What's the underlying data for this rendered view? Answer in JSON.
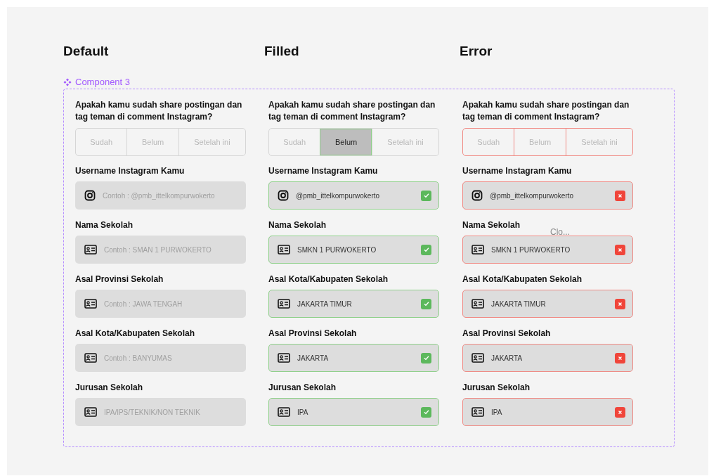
{
  "component_label": "Component 3",
  "columns": [
    {
      "title": "Default",
      "kind": "default",
      "question": "Apakah kamu sudah share postingan dan tag teman di comment Instagram?",
      "options": [
        {
          "label": "Sudah",
          "selected": false
        },
        {
          "label": "Belum",
          "selected": false
        },
        {
          "label": "Setelah ini",
          "selected": false
        }
      ],
      "fields": [
        {
          "label": "Username Instagram Kamu",
          "kind": "instagram",
          "placeholder": "Contoh : @pmb_ittelkompurwokerto"
        },
        {
          "label": "Nama Sekolah",
          "kind": "card",
          "placeholder": "Contoh : SMAN 1 PURWOKERTO"
        },
        {
          "label": "Asal Provinsi Sekolah",
          "kind": "card",
          "placeholder": "Contoh : JAWA TENGAH"
        },
        {
          "label": "Asal Kota/Kabupaten Sekolah",
          "kind": "card",
          "placeholder": "Contoh : BANYUMAS"
        },
        {
          "label": "Jurusan Sekolah",
          "kind": "card",
          "placeholder": "IPA/IPS/TEKNIK/NON TEKNIK"
        }
      ]
    },
    {
      "title": "Filled",
      "kind": "success",
      "question": "Apakah kamu sudah share postingan dan tag teman di comment Instagram?",
      "options": [
        {
          "label": "Sudah",
          "selected": false
        },
        {
          "label": "Belum",
          "selected": true
        },
        {
          "label": "Setelah ini",
          "selected": false
        }
      ],
      "fields": [
        {
          "label": "Username Instagram Kamu",
          "kind": "instagram",
          "value": "@pmb_ittelkompurwokerto"
        },
        {
          "label": "Nama Sekolah",
          "kind": "card",
          "value": "SMKN 1 PURWOKERTO"
        },
        {
          "label": "Asal Kota/Kabupaten Sekolah",
          "kind": "card",
          "value": "JAKARTA TIMUR"
        },
        {
          "label": "Asal Provinsi Sekolah",
          "kind": "card",
          "value": "JAKARTA"
        },
        {
          "label": "Jurusan Sekolah",
          "kind": "card",
          "value": "IPA"
        }
      ]
    },
    {
      "title": "Error",
      "kind": "error",
      "question": "Apakah kamu sudah share postingan dan tag teman di comment Instagram?",
      "options": [
        {
          "label": "Sudah",
          "selected": false
        },
        {
          "label": "Belum",
          "selected": false
        },
        {
          "label": "Setelah ini",
          "selected": false
        }
      ],
      "overlay_text": "Clo...",
      "fields": [
        {
          "label": "Username Instagram Kamu",
          "kind": "instagram",
          "value": "@pmb_ittelkompurwokerto"
        },
        {
          "label": "Nama Sekolah",
          "kind": "card",
          "value": "SMKN 1 PURWOKERTO"
        },
        {
          "label": "Asal Kota/Kabupaten Sekolah",
          "kind": "card",
          "value": "JAKARTA TIMUR"
        },
        {
          "label": "Asal Provinsi Sekolah",
          "kind": "card",
          "value": "JAKARTA"
        },
        {
          "label": "Jurusan Sekolah",
          "kind": "card",
          "value": "IPA"
        }
      ]
    }
  ]
}
